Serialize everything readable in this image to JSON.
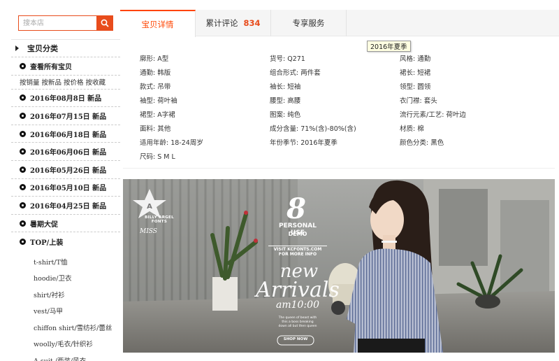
{
  "sidebar": {
    "search_placeholder": "搜本店",
    "search_icon": "search-icon",
    "category_title": "宝贝分类",
    "all_items": "查看所有宝贝",
    "sort_options": [
      "按销量",
      "按新品",
      "按价格",
      "按收藏"
    ],
    "categories": [
      "2016年08月8日 新品",
      "2016年07月15日 新品",
      "2016年06月18日 新品",
      "2016年06月06日 新品",
      "2016年05月26日 新品",
      "2016年05月10日 新品",
      "2016年04月25日 新品",
      "暑期大促",
      "TOP/上装"
    ],
    "subcategories": [
      "t-shirt/T恤",
      "hoodie/卫衣",
      "shirt/衬衫",
      "vest/马甲",
      "chiffon shirt/雪纺衫/蕾丝",
      "woolly/毛衣/针织衫",
      "A suit /西装/风衣"
    ]
  },
  "tabs": {
    "details": "宝贝详情",
    "reviews": "累计评论",
    "review_count": "834",
    "service": "专享服务",
    "accent_color": "#ff4400"
  },
  "tooltip": "2016年夏季",
  "attributes": [
    [
      "廓形: A型",
      "货号: Q271",
      "风格: 通勤"
    ],
    [
      "通勤: 韩版",
      "组合形式: 两件套",
      "裙长: 短裙"
    ],
    [
      "款式: 吊带",
      "袖长: 短袖",
      "领型: 圆领"
    ],
    [
      "袖型: 荷叶袖",
      "腰型: 高腰",
      "衣门襟: 套头"
    ],
    [
      "裙型: A字裙",
      "图案: 纯色",
      "流行元素/工艺: 荷叶边"
    ],
    [
      "面料: 其他",
      "成分含量: 71%(含)-80%(含)",
      "材质: 棉"
    ],
    [
      "适用年龄: 18-24周岁",
      "年份季节: 2016年夏季",
      "颜色分类: 黑色"
    ],
    [
      "尺码: S M L",
      "",
      ""
    ]
  ],
  "banner": {
    "logo_text": "BILLY ARGEL FONTS",
    "brand": "MISS",
    "personal_use": "PERSONAL USE",
    "demo": "DEMO",
    "visit": "VISIT KCFONTS.COM",
    "more_info": "FOR MORE INFO",
    "title_line1": "new",
    "title_line2": "Arrivals",
    "time": "am10:00",
    "tagline1": "The queen of beast with",
    "tagline2": "this a boss breaking",
    "tagline3": "down all but then queen",
    "shop_now": "SHOP NOW"
  }
}
